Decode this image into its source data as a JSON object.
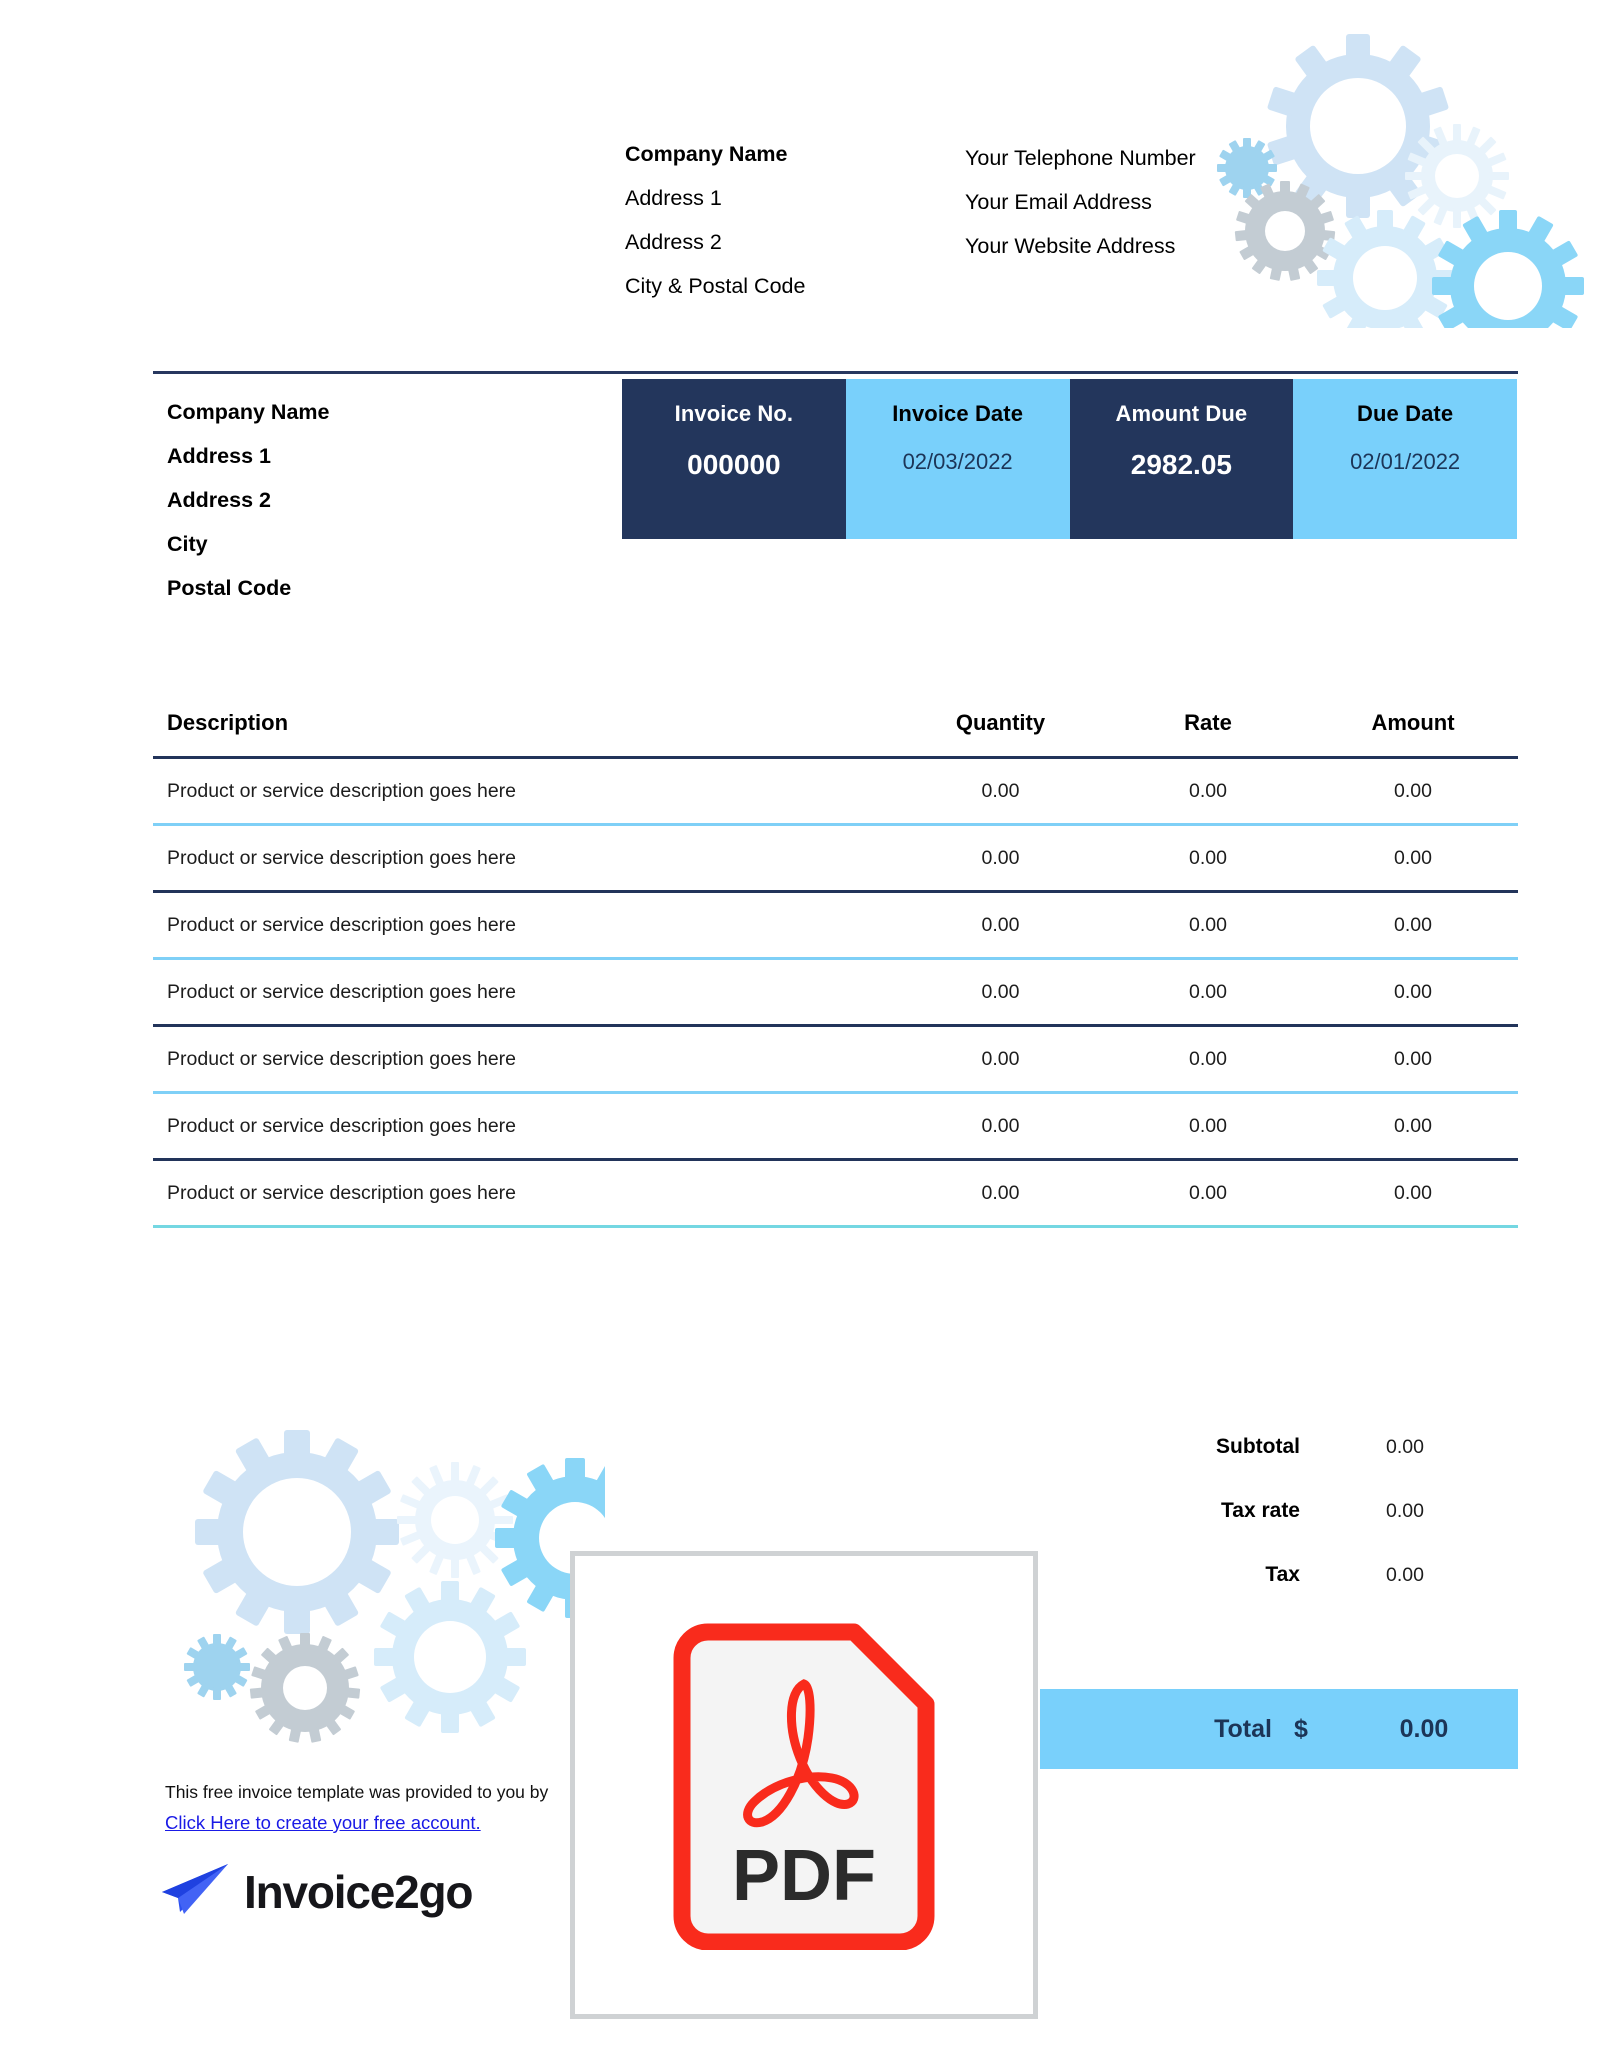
{
  "issuer": {
    "lines": [
      {
        "text": "Company Name",
        "bold": true
      },
      {
        "text": "Address 1",
        "bold": false
      },
      {
        "text": "Address 2",
        "bold": false
      },
      {
        "text": "City & Postal Code",
        "bold": false
      }
    ]
  },
  "contact": {
    "lines": [
      {
        "text": "Your Telephone Number"
      },
      {
        "text": "Your Email Address"
      },
      {
        "text": "Your Website Address"
      }
    ]
  },
  "bill_to": {
    "lines": [
      "Company Name",
      "Address 1",
      "Address 2",
      "City",
      "Postal Code"
    ]
  },
  "summary": {
    "cells": [
      {
        "label": "Invoice No.",
        "value": "000000",
        "style": "dark"
      },
      {
        "label": "Invoice Date",
        "value": "02/03/2022",
        "style": "light"
      },
      {
        "label": "Amount Due",
        "value": "2982.05",
        "style": "dark"
      },
      {
        "label": "Due Date",
        "value": "02/01/2022",
        "style": "light"
      }
    ]
  },
  "table": {
    "headers": {
      "description": "Description",
      "quantity": "Quantity",
      "rate": "Rate",
      "amount": "Amount"
    },
    "rows": [
      {
        "description": "Product or service description goes here",
        "quantity": "0.00",
        "rate": "0.00",
        "amount": "0.00",
        "rule": "blue"
      },
      {
        "description": "Product or service description goes here",
        "quantity": "0.00",
        "rate": "0.00",
        "amount": "0.00",
        "rule": "navy"
      },
      {
        "description": "Product or service description goes here",
        "quantity": "0.00",
        "rate": "0.00",
        "amount": "0.00",
        "rule": "blue"
      },
      {
        "description": "Product or service description goes here",
        "quantity": "0.00",
        "rate": "0.00",
        "amount": "0.00",
        "rule": "navy"
      },
      {
        "description": "Product or service description goes here",
        "quantity": "0.00",
        "rate": "0.00",
        "amount": "0.00",
        "rule": "blue"
      },
      {
        "description": "Product or service description goes here",
        "quantity": "0.00",
        "rate": "0.00",
        "amount": "0.00",
        "rule": "navy"
      },
      {
        "description": "Product or service description goes here",
        "quantity": "0.00",
        "rate": "0.00",
        "amount": "0.00",
        "rule": "teal"
      }
    ]
  },
  "totals": {
    "rows": [
      {
        "label": "Subtotal",
        "value": "0.00"
      },
      {
        "label": "Tax rate",
        "value": "0.00"
      },
      {
        "label": "Tax",
        "value": "0.00"
      }
    ],
    "total_label": "Total",
    "total_currency": "$",
    "total_value": "0.00"
  },
  "footer": {
    "note": "This free invoice template was provided to you by",
    "link": "Click Here to create your free account.",
    "brand": "Invoice2go"
  },
  "overlay": {
    "pdf_label": "PDF"
  },
  "colors": {
    "navy": "#23365c",
    "light_blue": "#79d0fb",
    "rule_navy": "#22345a",
    "rule_blue": "#7fd0f7",
    "rule_teal": "#74d7e2",
    "link_blue": "#1a1ae6",
    "pdf_red": "#f92b1c",
    "brand_blue": "#2b50f0"
  }
}
